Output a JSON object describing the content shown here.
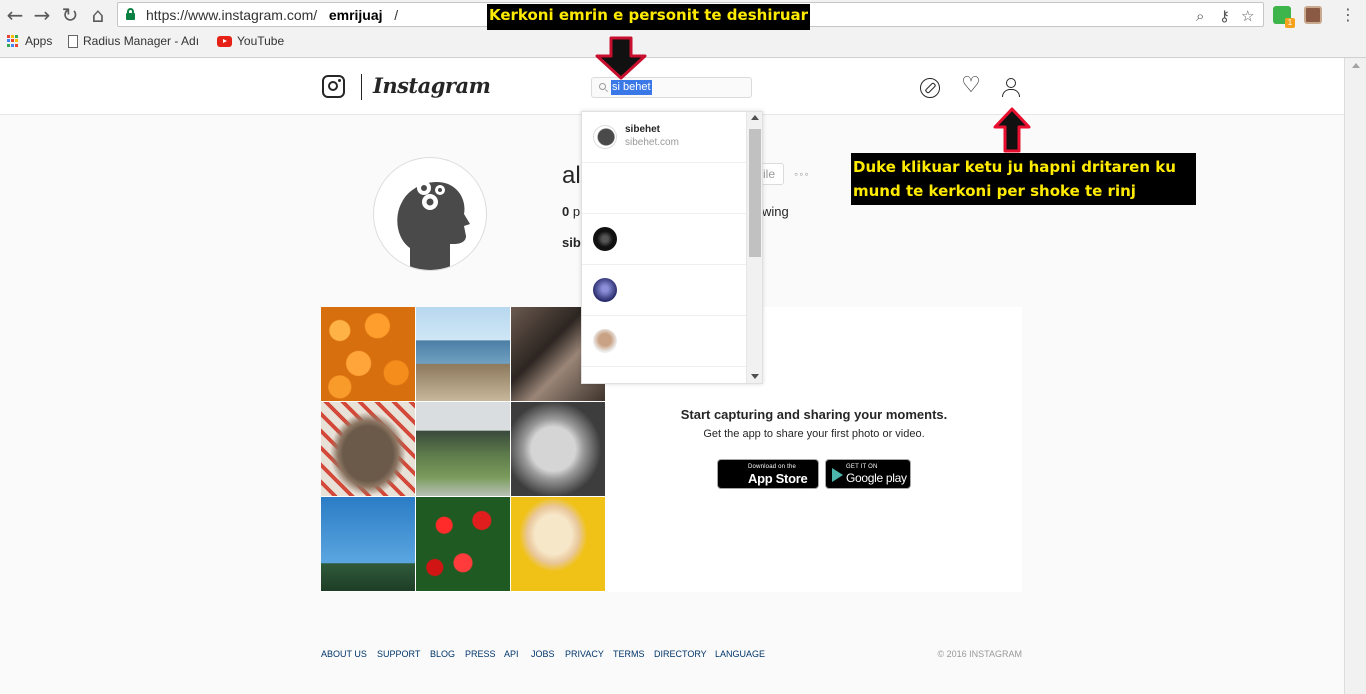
{
  "browser": {
    "url_base": "https://www.instagram.com/",
    "url_user": "emrijuaj",
    "url_tail": "/",
    "bookmarks": [
      {
        "label": "Apps"
      },
      {
        "label": "Radius Manager - Adı"
      },
      {
        "label": "YouTube"
      }
    ],
    "extension_badge": "1"
  },
  "instagram": {
    "wordmark": "Instagram",
    "search_value": "si behet",
    "profile": {
      "username_fragment": "al",
      "edit_fragment": "ile",
      "options": "◦◦◦",
      "posts_count": "0",
      "posts_fragment": "p",
      "following_fragment": "wing",
      "bio_fragment": "sibe"
    },
    "search_results": [
      {
        "name": "sibehet",
        "sub": "sibehet.com"
      },
      {
        "name": "",
        "sub": ""
      },
      {
        "name": "",
        "sub": ""
      },
      {
        "name": "",
        "sub": ""
      },
      {
        "name": "",
        "sub": ""
      }
    ],
    "promo": {
      "title": "Start capturing and sharing your moments.",
      "subtitle": "Get the app to share your first photo or video.",
      "appstore_small": "Download on the",
      "appstore_big": "App Store",
      "googleplay_small": "GET IT ON",
      "googleplay_big": "Google play"
    },
    "footer_links": [
      "ABOUT US",
      "SUPPORT",
      "BLOG",
      "PRESS",
      "API",
      "JOBS",
      "PRIVACY",
      "TERMS",
      "DIRECTORY",
      "LANGUAGE"
    ],
    "copyright": "© 2016 INSTAGRAM"
  },
  "annotations": {
    "top": "Kerkoni emrin e personit te deshiruar",
    "right": "Duke klikuar ketu ju hapni dritaren ku mund te kerkoni per shoke te rinj",
    "arrow_color": "#c8102e"
  },
  "colors": {
    "highlight": "#3b78e7",
    "link": "#003569",
    "note_bg": "#000000",
    "note_text": "#ffeb00"
  }
}
